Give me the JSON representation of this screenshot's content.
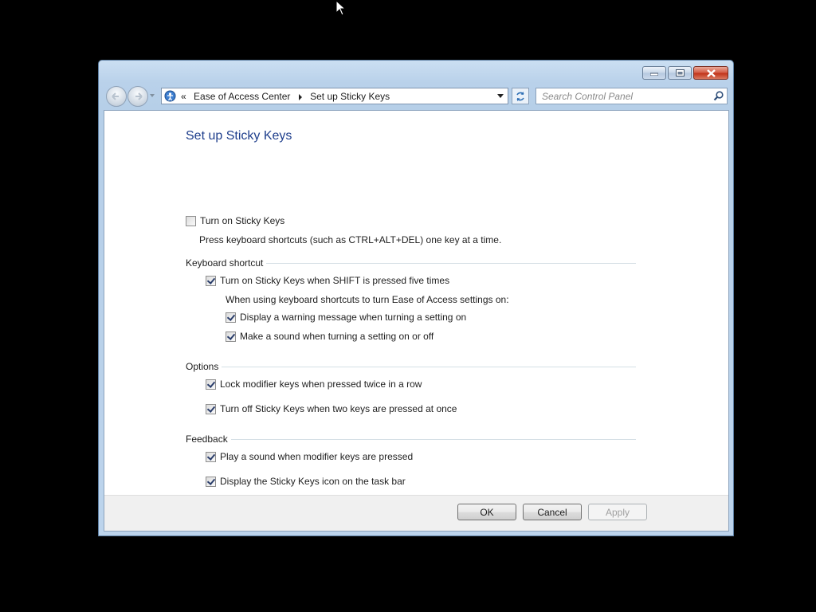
{
  "window": {
    "address_bar": {
      "chevron": "«",
      "crumbs": [
        "Ease of Access Center",
        "Set up Sticky Keys"
      ]
    },
    "search": {
      "placeholder": "Search Control Panel"
    }
  },
  "page": {
    "title": "Set up Sticky Keys",
    "turn_on": {
      "label": "Turn on Sticky Keys",
      "checked": false
    },
    "description": "Press keyboard shortcuts (such as CTRL+ALT+DEL) one key at a time.",
    "keyboard_shortcut": {
      "heading": "Keyboard shortcut",
      "shift_five": {
        "label": "Turn on Sticky Keys when SHIFT is pressed five times",
        "checked": true
      },
      "note": "When using keyboard shortcuts to turn Ease of Access settings on:",
      "warning": {
        "label": "Display a warning message when turning a setting on",
        "checked": true
      },
      "sound": {
        "label": "Make a sound when turning a setting on or off",
        "checked": true
      }
    },
    "options": {
      "heading": "Options",
      "lock_modifier": {
        "label": "Lock modifier keys when pressed twice in a row",
        "checked": true
      },
      "turn_off_two": {
        "label": "Turn off Sticky Keys when two keys are pressed at once",
        "checked": true
      }
    },
    "feedback": {
      "heading": "Feedback",
      "play_sound": {
        "label": "Play a sound when modifier keys are pressed",
        "checked": true
      },
      "taskbar_icon": {
        "label": "Display the Sticky Keys icon on the task bar",
        "checked": true
      }
    }
  },
  "buttons": {
    "ok": "OK",
    "cancel": "Cancel",
    "apply": "Apply"
  }
}
